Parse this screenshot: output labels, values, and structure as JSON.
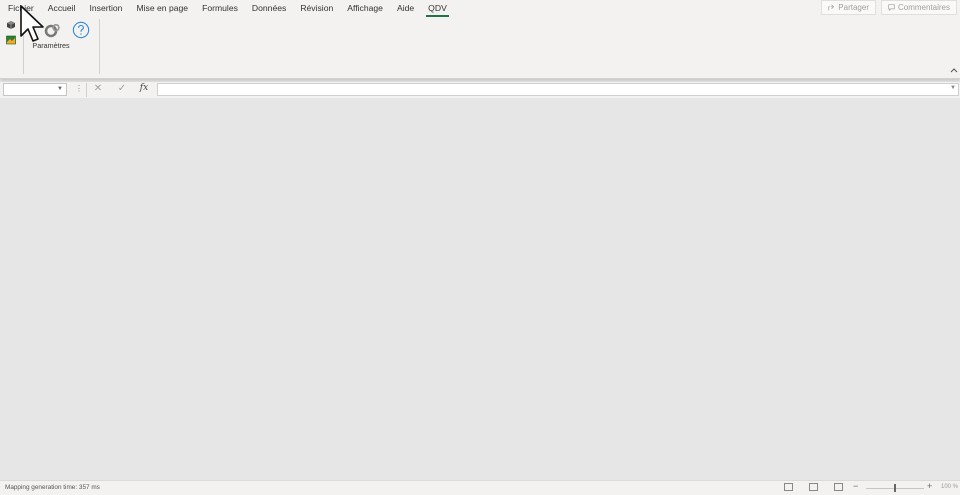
{
  "ribbon": {
    "tabs": [
      {
        "label": "Fichier",
        "active": false
      },
      {
        "label": "Accueil",
        "active": false
      },
      {
        "label": "Insertion",
        "active": false
      },
      {
        "label": "Mise en page",
        "active": false
      },
      {
        "label": "Formules",
        "active": false
      },
      {
        "label": "Données",
        "active": false
      },
      {
        "label": "Révision",
        "active": false
      },
      {
        "label": "Affichage",
        "active": false
      },
      {
        "label": "Aide",
        "active": false
      },
      {
        "label": "QDV",
        "active": true
      }
    ],
    "share_label": "Partager",
    "comments_label": "Commentaires",
    "parametres_label": "Paramètres",
    "accent_color": "#217346",
    "help_icon": "question-circle-icon"
  },
  "formula_bar": {
    "namebox_value": "",
    "formula_value": "",
    "cancel_glyph": "✕",
    "enter_glyph": "✓",
    "fx_label": "fx"
  },
  "status": {
    "text": "Mapping generation time: 357 ms",
    "zoom_minus": "−",
    "zoom_plus": "+",
    "zoom": "100 %"
  }
}
